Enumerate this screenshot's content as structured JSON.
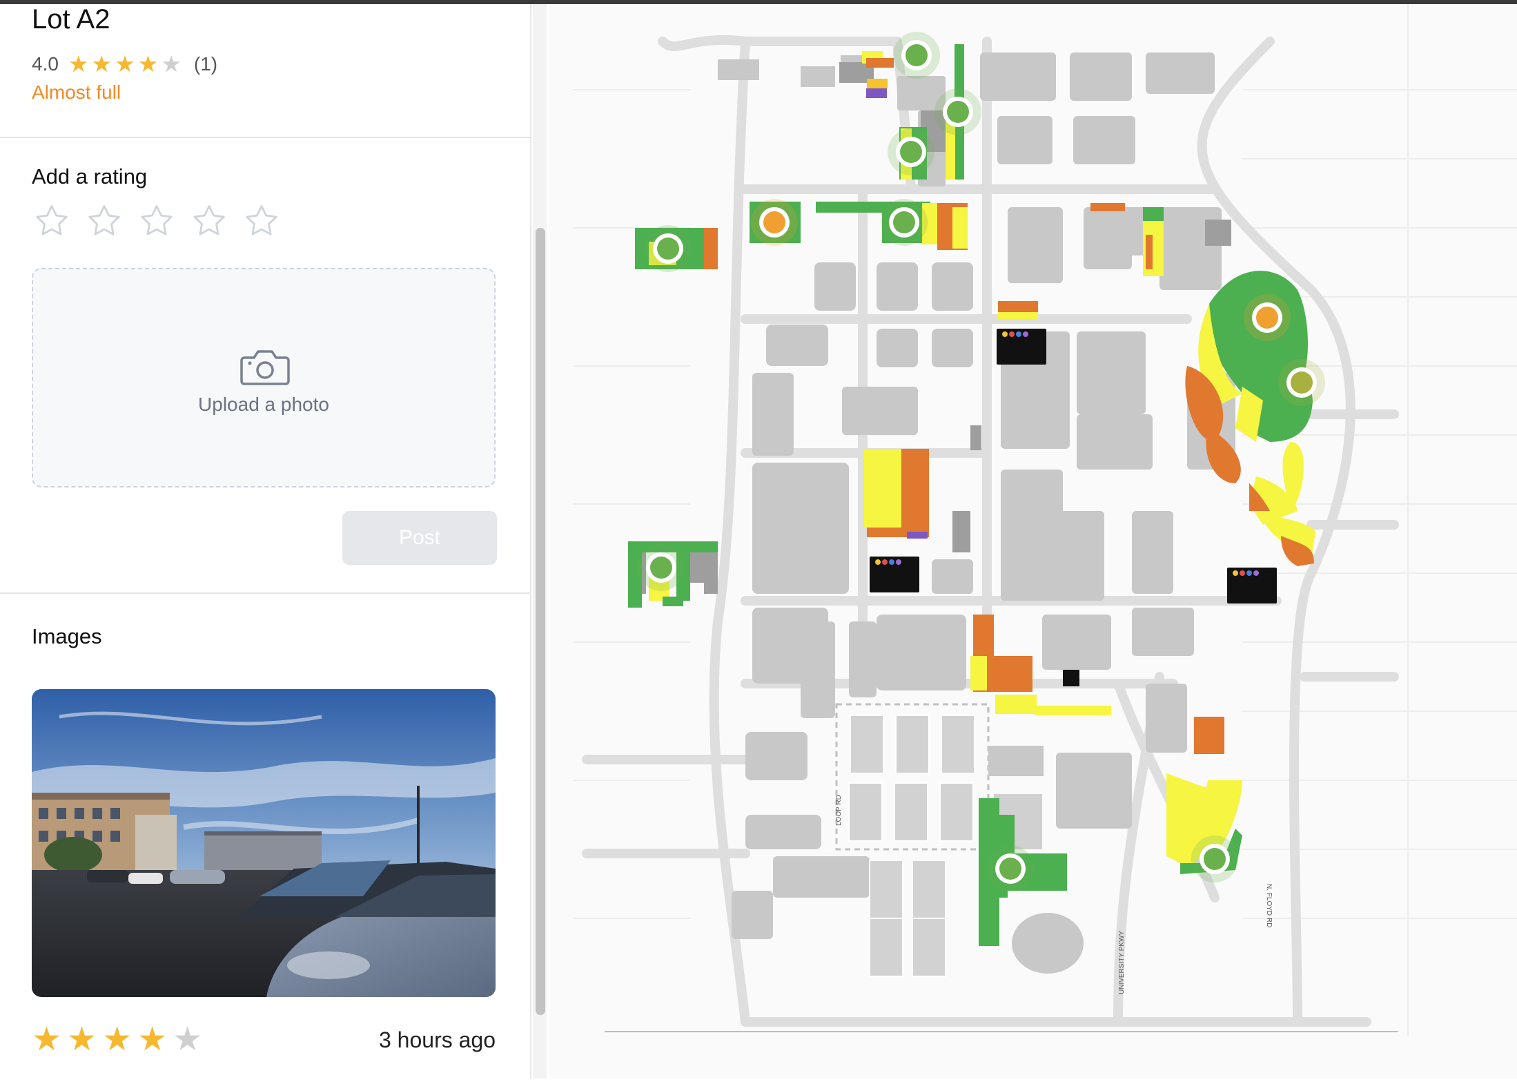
{
  "lot": {
    "title": "Lot A2",
    "rating_value": "4.0",
    "rating_stars": 4,
    "rating_count": "(1)",
    "status": "Almost full",
    "status_color": "#f08a24"
  },
  "add_rating": {
    "title": "Add a rating",
    "max_stars": 5
  },
  "upload": {
    "label": "Upload a photo",
    "icon": "camera-icon"
  },
  "post_button": {
    "label": "Post",
    "enabled": false
  },
  "images": {
    "title": "Images",
    "reviews": [
      {
        "stars": 4,
        "max_stars": 5,
        "time": "3 hours ago"
      }
    ]
  },
  "map": {
    "street_labels": [
      "LOOP RD",
      "UNIVERSITY PKWY",
      "N. FLOYD RD"
    ],
    "markers": [
      {
        "status": "available",
        "color": "#6ab04c"
      },
      {
        "status": "available",
        "color": "#6ab04c"
      },
      {
        "status": "available",
        "color": "#6ab04c"
      },
      {
        "status": "almost-full",
        "color": "#f0a030"
      },
      {
        "status": "available",
        "color": "#6ab04c"
      },
      {
        "status": "available",
        "color": "#6ab04c"
      },
      {
        "status": "almost-full",
        "color": "#f0a030"
      },
      {
        "status": "moderate",
        "color": "#a8b040"
      },
      {
        "status": "available",
        "color": "#6ab04c"
      },
      {
        "status": "available",
        "color": "#6ab04c"
      },
      {
        "status": "available",
        "color": "#6ab04c"
      }
    ],
    "lot_colors": {
      "green": "#4caf50",
      "yellow": "#f5f542",
      "orange": "#e07830",
      "gray": "#9e9e9e",
      "purple": "#7e57c2"
    }
  }
}
